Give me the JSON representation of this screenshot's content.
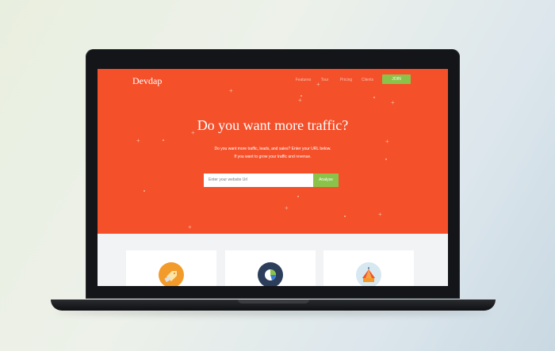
{
  "site": {
    "brand": "Devdap",
    "nav": [
      "Features",
      "Tour",
      "Pricing",
      "Clients"
    ],
    "join_label": "JOIN"
  },
  "hero": {
    "headline": "Do you want more traffic?",
    "subtext_line1": "Do you want more traffic, leads, and sales? Enter your URL below.",
    "subtext_line2": "If you want to grow your traffic and revenue.",
    "search_placeholder": "Enter your website Url",
    "analyse_label": "Analyse"
  },
  "cards": [
    {
      "icon": "tag-icon",
      "color": "#f29b2b"
    },
    {
      "icon": "pie-chart-icon",
      "color": "#2c3e5a"
    },
    {
      "icon": "carousel-tent-icon",
      "color": "#d7e8f0"
    }
  ],
  "colors": {
    "hero_bg": "#f4502a",
    "accent_green": "#8bc34a"
  }
}
